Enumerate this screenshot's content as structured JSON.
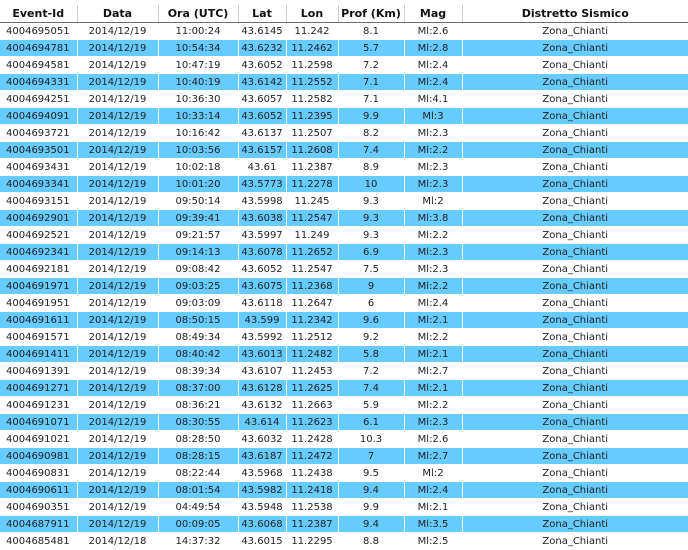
{
  "colors": {
    "alt_row": "#66ccff",
    "header_rule": "#6e6e6e"
  },
  "headers": [
    "Event-Id",
    "Data",
    "Ora (UTC)",
    "Lat",
    "Lon",
    "Prof (Km)",
    "Mag",
    "Distretto Sismico"
  ],
  "rows": [
    [
      "4004695051",
      "2014/12/19",
      "11:00:24",
      "43.6145",
      "11.242",
      "8.1",
      "Ml:2.6",
      "Zona_Chianti"
    ],
    [
      "4004694781",
      "2014/12/19",
      "10:54:34",
      "43.6232",
      "11.2462",
      "5.7",
      "Ml:2.8",
      "Zona_Chianti"
    ],
    [
      "4004694581",
      "2014/12/19",
      "10:47:19",
      "43.6052",
      "11.2598",
      "7.2",
      "Ml:2.4",
      "Zona_Chianti"
    ],
    [
      "4004694331",
      "2014/12/19",
      "10:40:19",
      "43.6142",
      "11.2552",
      "7.1",
      "Ml:2.4",
      "Zona_Chianti"
    ],
    [
      "4004694251",
      "2014/12/19",
      "10:36:30",
      "43.6057",
      "11.2582",
      "7.1",
      "Ml:4.1",
      "Zona_Chianti"
    ],
    [
      "4004694091",
      "2014/12/19",
      "10:33:14",
      "43.6052",
      "11.2395",
      "9.9",
      "Ml:3",
      "Zona_Chianti"
    ],
    [
      "4004693721",
      "2014/12/19",
      "10:16:42",
      "43.6137",
      "11.2507",
      "8.2",
      "Ml:2.3",
      "Zona_Chianti"
    ],
    [
      "4004693501",
      "2014/12/19",
      "10:03:56",
      "43.6157",
      "11.2608",
      "7.4",
      "Ml:2.2",
      "Zona_Chianti"
    ],
    [
      "4004693431",
      "2014/12/19",
      "10:02:18",
      "43.61",
      "11.2387",
      "8.9",
      "Ml:2.3",
      "Zona_Chianti"
    ],
    [
      "4004693341",
      "2014/12/19",
      "10:01:20",
      "43.5773",
      "11.2278",
      "10",
      "Ml:2.3",
      "Zona_Chianti"
    ],
    [
      "4004693151",
      "2014/12/19",
      "09:50:14",
      "43.5998",
      "11.245",
      "9.3",
      "Ml:2",
      "Zona_Chianti"
    ],
    [
      "4004692901",
      "2014/12/19",
      "09:39:41",
      "43.6038",
      "11.2547",
      "9.3",
      "Ml:3.8",
      "Zona_Chianti"
    ],
    [
      "4004692521",
      "2014/12/19",
      "09:21:57",
      "43.5997",
      "11.249",
      "9.3",
      "Ml:2.2",
      "Zona_Chianti"
    ],
    [
      "4004692341",
      "2014/12/19",
      "09:14:13",
      "43.6078",
      "11.2652",
      "6.9",
      "Ml:2.3",
      "Zona_Chianti"
    ],
    [
      "4004692181",
      "2014/12/19",
      "09:08:42",
      "43.6052",
      "11.2547",
      "7.5",
      "Ml:2.3",
      "Zona_Chianti"
    ],
    [
      "4004691971",
      "2014/12/19",
      "09:03:25",
      "43.6075",
      "11.2368",
      "9",
      "Ml:2.2",
      "Zona_Chianti"
    ],
    [
      "4004691951",
      "2014/12/19",
      "09:03:09",
      "43.6118",
      "11.2647",
      "6",
      "Ml:2.4",
      "Zona_Chianti"
    ],
    [
      "4004691611",
      "2014/12/19",
      "08:50:15",
      "43.599",
      "11.2342",
      "9.6",
      "Ml:2.1",
      "Zona_Chianti"
    ],
    [
      "4004691571",
      "2014/12/19",
      "08:49:34",
      "43.5992",
      "11.2512",
      "9.2",
      "Ml:2.2",
      "Zona_Chianti"
    ],
    [
      "4004691411",
      "2014/12/19",
      "08:40:42",
      "43.6013",
      "11.2482",
      "5.8",
      "Ml:2.1",
      "Zona_Chianti"
    ],
    [
      "4004691391",
      "2014/12/19",
      "08:39:34",
      "43.6107",
      "11.2453",
      "7.2",
      "Ml:2.7",
      "Zona_Chianti"
    ],
    [
      "4004691271",
      "2014/12/19",
      "08:37:00",
      "43.6128",
      "11.2625",
      "7.4",
      "Ml:2.1",
      "Zona_Chianti"
    ],
    [
      "4004691231",
      "2014/12/19",
      "08:36:21",
      "43.6132",
      "11.2663",
      "5.9",
      "Ml:2.2",
      "Zona_Chianti"
    ],
    [
      "4004691071",
      "2014/12/19",
      "08:30:55",
      "43.614",
      "11.2623",
      "6.1",
      "Ml:2.3",
      "Zona_Chianti"
    ],
    [
      "4004691021",
      "2014/12/19",
      "08:28:50",
      "43.6032",
      "11.2428",
      "10.3",
      "Ml:2.6",
      "Zona_Chianti"
    ],
    [
      "4004690981",
      "2014/12/19",
      "08:28:15",
      "43.6187",
      "11.2472",
      "7",
      "Ml:2.7",
      "Zona_Chianti"
    ],
    [
      "4004690831",
      "2014/12/19",
      "08:22:44",
      "43.5968",
      "11.2438",
      "9.5",
      "Ml:2",
      "Zona_Chianti"
    ],
    [
      "4004690611",
      "2014/12/19",
      "08:01:54",
      "43.5982",
      "11.2418",
      "9.4",
      "Ml:2.4",
      "Zona_Chianti"
    ],
    [
      "4004690351",
      "2014/12/19",
      "04:49:54",
      "43.5948",
      "11.2538",
      "9.9",
      "Ml:2.1",
      "Zona_Chianti"
    ],
    [
      "4004687911",
      "2014/12/19",
      "00:09:05",
      "43.6068",
      "11.2387",
      "9.4",
      "Ml:3.5",
      "Zona_Chianti"
    ],
    [
      "4004685481",
      "2014/12/18",
      "14:37:32",
      "43.6015",
      "11.2295",
      "8.8",
      "Ml:2.5",
      "Zona_Chianti"
    ]
  ]
}
